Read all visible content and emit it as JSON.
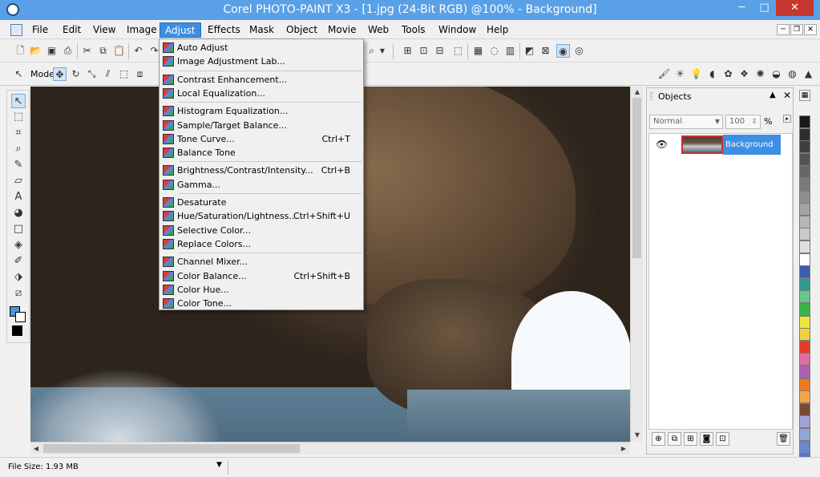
{
  "window": {
    "title": "Corel PHOTO-PAINT X3 - [1.jpg (24-Bit RGB) @100% - Background]",
    "min_glyph": "─",
    "max_glyph": "□",
    "close_glyph": "✕"
  },
  "menubar": {
    "items": [
      {
        "label": "File"
      },
      {
        "label": "Edit"
      },
      {
        "label": "View"
      },
      {
        "label": "Image"
      },
      {
        "label": "Adjust"
      },
      {
        "label": "Effects"
      },
      {
        "label": "Mask"
      },
      {
        "label": "Object"
      },
      {
        "label": "Movie"
      },
      {
        "label": "Web"
      },
      {
        "label": "Tools"
      },
      {
        "label": "Window"
      },
      {
        "label": "Help"
      }
    ],
    "active": "Adjust",
    "mdi": {
      "min": "─",
      "restore": "❐",
      "close": "✕"
    }
  },
  "toolbar2": {
    "mode_label": "Mode"
  },
  "adjust_menu": {
    "groups": [
      [
        {
          "label": "Auto Adjust",
          "shortcut": ""
        },
        {
          "label": "Image Adjustment Lab...",
          "shortcut": ""
        }
      ],
      [
        {
          "label": "Contrast Enhancement...",
          "shortcut": ""
        },
        {
          "label": "Local Equalization...",
          "shortcut": ""
        }
      ],
      [
        {
          "label": "Histogram Equalization...",
          "shortcut": ""
        },
        {
          "label": "Sample/Target Balance...",
          "shortcut": ""
        },
        {
          "label": "Tone Curve...",
          "shortcut": "Ctrl+T"
        },
        {
          "label": "Balance Tone",
          "shortcut": ""
        }
      ],
      [
        {
          "label": "Brightness/Contrast/Intensity...",
          "shortcut": "Ctrl+B"
        },
        {
          "label": "Gamma...",
          "shortcut": ""
        }
      ],
      [
        {
          "label": "Desaturate",
          "shortcut": ""
        },
        {
          "label": "Hue/Saturation/Lightness...",
          "shortcut": "Ctrl+Shift+U"
        },
        {
          "label": "Selective Color...",
          "shortcut": ""
        },
        {
          "label": "Replace Colors...",
          "shortcut": ""
        }
      ],
      [
        {
          "label": "Channel Mixer...",
          "shortcut": ""
        },
        {
          "label": "Color Balance...",
          "shortcut": "Ctrl+Shift+B"
        },
        {
          "label": "Color Hue...",
          "shortcut": ""
        },
        {
          "label": "Color Tone...",
          "shortcut": ""
        }
      ]
    ]
  },
  "objects_docker": {
    "title": "Objects",
    "blend_mode": "Normal",
    "opacity": "100",
    "opacity_unit": "%",
    "layers": [
      {
        "name": "Background",
        "visible": true,
        "selected": true
      }
    ]
  },
  "statusbar": {
    "file_size": "File Size: 1.93 MB"
  },
  "palette": {
    "colors": [
      "#1a1a1a",
      "#2e2e2e",
      "#3f3f3f",
      "#535353",
      "#676767",
      "#7b7b7b",
      "#8f8f8f",
      "#a3a3a3",
      "#b7b7b7",
      "#cbcbcb",
      "#dfdfdf",
      "#ffffff",
      "#3a5fb0",
      "#2f9c8f",
      "#63c78a",
      "#3ab34a",
      "#e8e83c",
      "#f0d23c",
      "#e43a2c",
      "#e06ca0",
      "#b05fb0",
      "#f07a1e",
      "#f5a54a",
      "#7a4a34",
      "#a4a0d8",
      "#8fa6d8",
      "#6d88c8",
      "#5f78b8"
    ]
  },
  "colors": {
    "accent": "#3d8ee0",
    "title_bar": "#5aa0e6",
    "close": "#c7372f"
  }
}
